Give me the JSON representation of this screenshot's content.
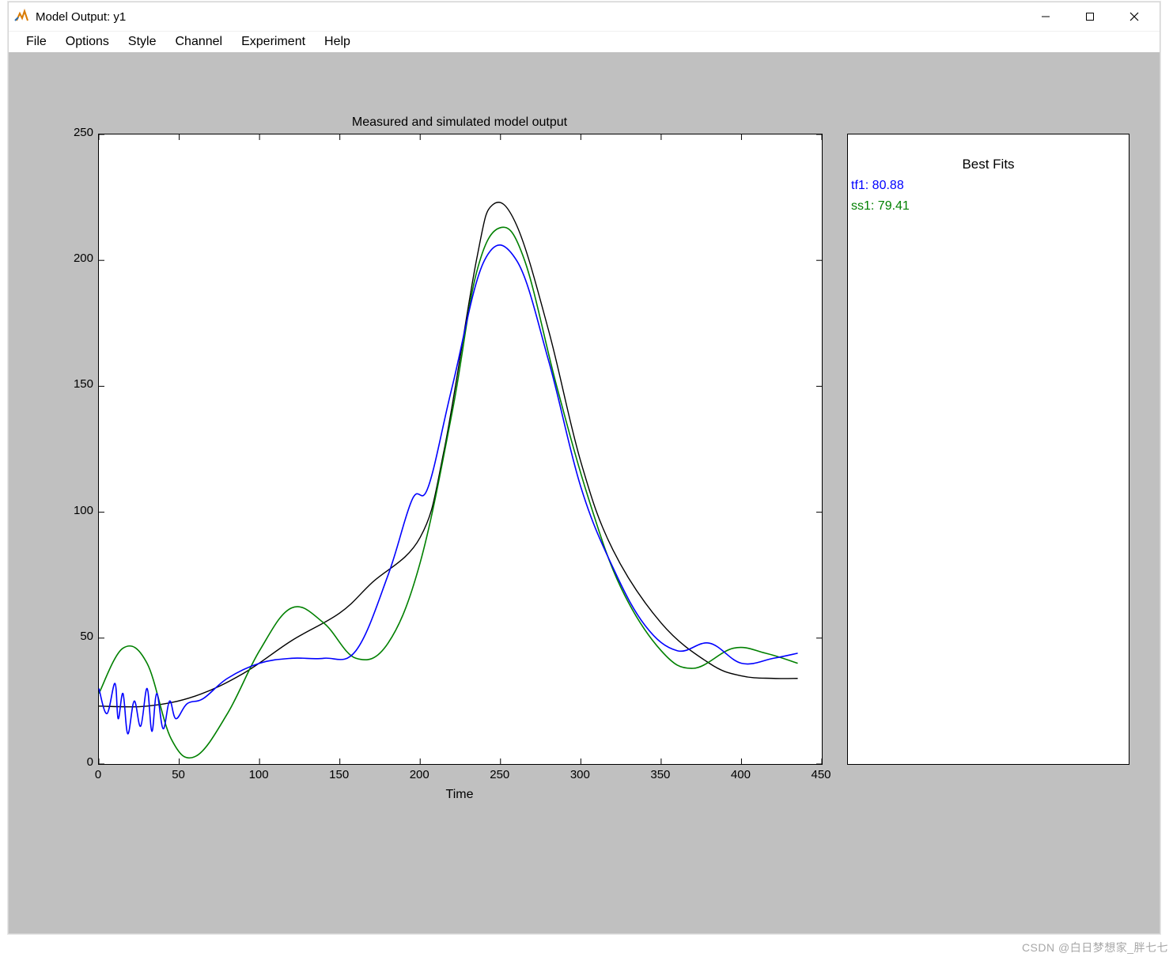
{
  "window": {
    "title": "Model Output: y1",
    "icon_name": "matlab-icon"
  },
  "menus": [
    "File",
    "Options",
    "Style",
    "Channel",
    "Experiment",
    "Help"
  ],
  "chart_title": "Measured and simulated model output",
  "xlabel": "Time",
  "x_ticks": [
    0,
    50,
    100,
    150,
    200,
    250,
    300,
    350,
    400,
    450
  ],
  "y_ticks": [
    0,
    50,
    100,
    150,
    200,
    250
  ],
  "legend": {
    "title": "Best Fits",
    "items": [
      {
        "label": "tf1: 80.88",
        "color": "#0000ff"
      },
      {
        "label": "ss1: 79.41",
        "color": "#008000"
      }
    ]
  },
  "colors": {
    "measured": "#000000",
    "tf1": "#0000ff",
    "ss1": "#008000",
    "axes_bg": "#ffffff",
    "fig_bg": "#c0c0c0"
  },
  "watermark": "CSDN @白日梦想家_胖七七",
  "chart_data": {
    "type": "line",
    "title": "Measured and simulated model output",
    "xlabel": "Time",
    "ylabel": "",
    "xlim": [
      0,
      450
    ],
    "ylim": [
      0,
      250
    ],
    "legend": [
      "measured (black)",
      "tf1 (blue)",
      "ss1 (green)"
    ],
    "series": [
      {
        "name": "measured",
        "color": "#000000",
        "x": [
          0,
          30,
          60,
          90,
          120,
          150,
          170,
          200,
          215,
          235,
          245,
          260,
          280,
          300,
          320,
          350,
          380,
          400,
          420,
          435
        ],
        "y": [
          23,
          23,
          27,
          36,
          49,
          60,
          72,
          90,
          125,
          200,
          222,
          214,
          172,
          120,
          85,
          56,
          40,
          35,
          34,
          34
        ]
      },
      {
        "name": "tf1",
        "color": "#0000ff",
        "x": [
          0,
          5,
          10,
          12,
          15,
          18,
          22,
          26,
          30,
          33,
          36,
          40,
          44,
          48,
          55,
          65,
          80,
          100,
          120,
          140,
          160,
          180,
          195,
          205,
          220,
          240,
          260,
          280,
          300,
          320,
          340,
          360,
          380,
          400,
          420,
          435
        ],
        "y": [
          30,
          20,
          32,
          18,
          28,
          12,
          25,
          15,
          30,
          13,
          28,
          14,
          25,
          18,
          24,
          26,
          34,
          40,
          42,
          42,
          45,
          75,
          105,
          110,
          150,
          200,
          200,
          160,
          110,
          78,
          55,
          45,
          48,
          40,
          42,
          44
        ]
      },
      {
        "name": "ss1",
        "color": "#008000",
        "x": [
          0,
          15,
          30,
          45,
          60,
          80,
          100,
          120,
          140,
          160,
          180,
          200,
          220,
          235,
          250,
          265,
          285,
          305,
          325,
          350,
          370,
          395,
          415,
          435
        ],
        "y": [
          28,
          46,
          40,
          10,
          3,
          20,
          45,
          62,
          56,
          42,
          48,
          80,
          140,
          195,
          213,
          200,
          150,
          105,
          70,
          45,
          38,
          46,
          44,
          40
        ]
      }
    ]
  }
}
